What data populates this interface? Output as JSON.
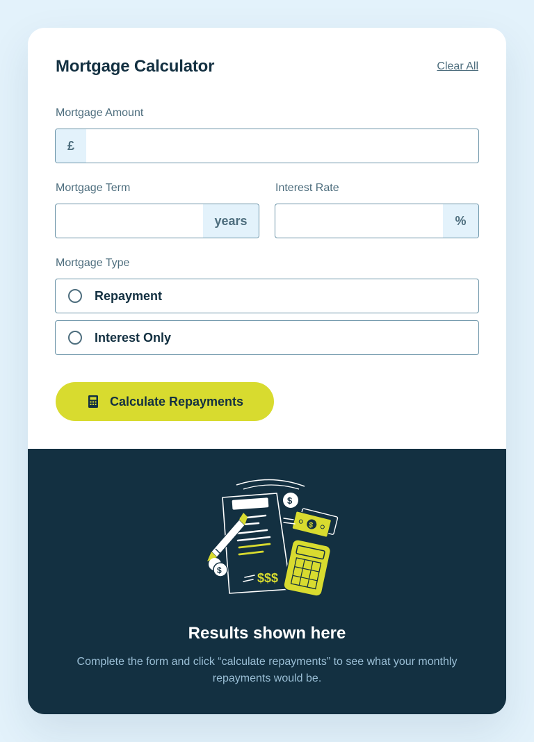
{
  "header": {
    "title": "Mortgage Calculator",
    "clear_label": "Clear All"
  },
  "amount": {
    "label": "Mortgage Amount",
    "prefix": "£",
    "value": ""
  },
  "term": {
    "label": "Mortgage Term",
    "suffix": "years",
    "value": ""
  },
  "rate": {
    "label": "Interest Rate",
    "suffix": "%",
    "value": ""
  },
  "type": {
    "label": "Mortgage Type",
    "options": [
      {
        "label": "Repayment",
        "selected": false
      },
      {
        "label": "Interest Only",
        "selected": false
      }
    ]
  },
  "button": {
    "label": "Calculate Repayments",
    "icon": "calculator-icon"
  },
  "results": {
    "illustration": "empty-results-illustration",
    "title": "Results shown here",
    "text": "Complete the form and click “calculate repayments” to see what your monthly repayments would be."
  },
  "colors": {
    "page_bg": "#e3f2fb",
    "card_bg": "#ffffff",
    "dark": "#133041",
    "muted": "#4e6e7e",
    "border": "#6b94a8",
    "addon_bg": "#e3f2fb",
    "lime": "#d8db2f",
    "results_text": "#9abed5"
  }
}
